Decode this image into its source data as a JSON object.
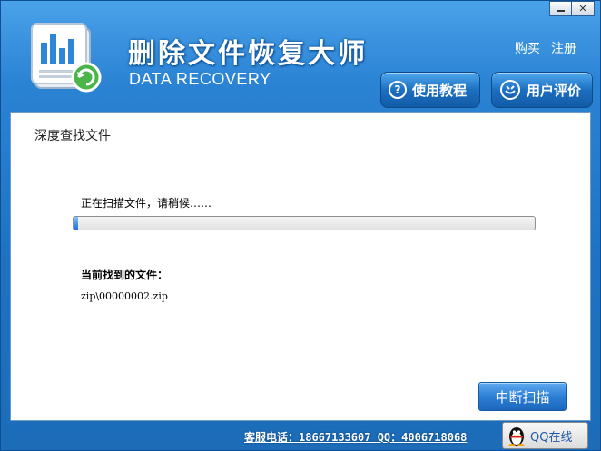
{
  "window": {
    "minimize_icon": "minimize-icon",
    "close_label": "✕"
  },
  "header": {
    "title": "删除文件恢复大师",
    "subtitle": "DATA RECOVERY",
    "links": {
      "buy": "购买",
      "register": "注册"
    },
    "help_button": "使用教程",
    "rating_button": "用户评价",
    "help_icon": "question-icon",
    "rating_icon": "rating-icon"
  },
  "content": {
    "section_title": "深度查找文件",
    "scan_status": "正在扫描文件，请稍候……",
    "progress": 0.01,
    "found_label": "当前找到的文件：",
    "found_file": "zip\\00000002.zip",
    "stop_button": "中断扫描"
  },
  "footer": {
    "contact": "客服电话：18667133607 QQ：4006718068",
    "qq_button": "QQ在线",
    "qq_icon": "qq-penguin-icon"
  },
  "colors": {
    "accent": "#1f73c3",
    "content_bg": "#ffffff",
    "progress_fill": "#1e6fd6"
  }
}
